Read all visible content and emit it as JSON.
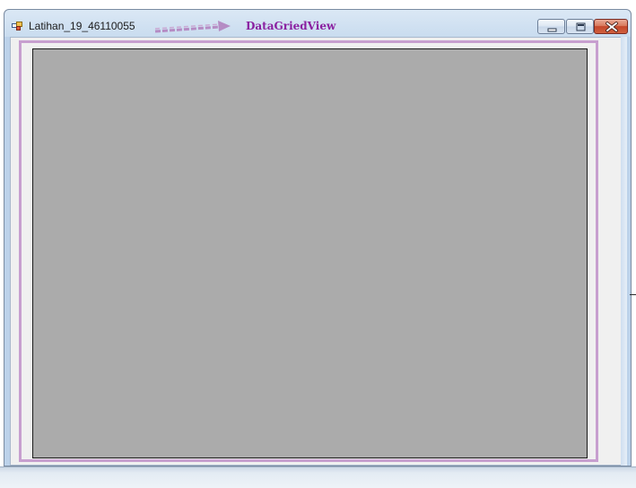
{
  "window": {
    "title": "Latihan_19_46110055",
    "annotation_label": "DataGriedView",
    "annotation_color": "#8a1fa0",
    "highlight_color": "#c79fcf"
  },
  "icons": {
    "app": "app-window-icon",
    "minimize": "minimize-icon",
    "maximize": "maximize-icon",
    "close": "close-icon",
    "arrow": "arrow-right-icon"
  },
  "datagrid": {
    "background": "#ababab"
  }
}
